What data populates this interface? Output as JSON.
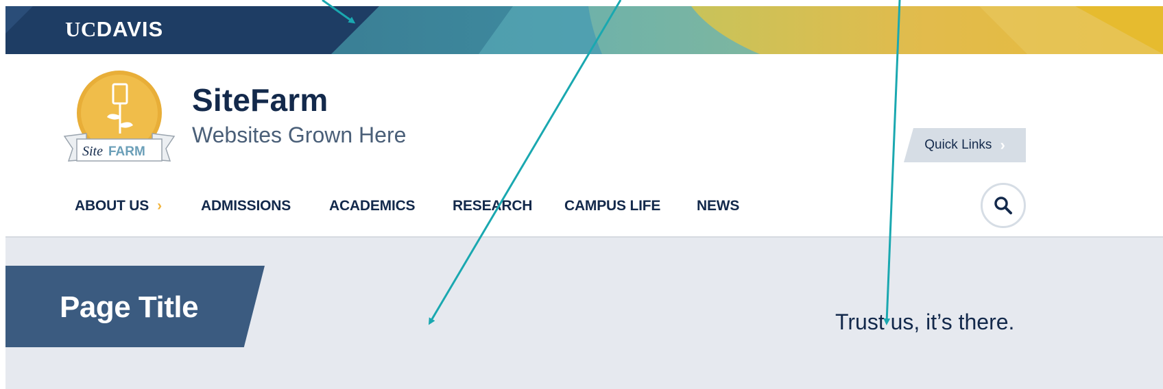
{
  "banner": {
    "brand_uc": "UC",
    "brand_davis": "DAVIS"
  },
  "branding": {
    "logo_text_site": "Site",
    "logo_text_farm": "FARM",
    "site_name": "SiteFarm",
    "slogan": "Websites Grown Here",
    "quick_links_label": "Quick Links"
  },
  "nav": {
    "items": [
      {
        "label": "ABOUT US",
        "has_arrow": true
      },
      {
        "label": "ADMISSIONS"
      },
      {
        "label": "ACADEMICS"
      },
      {
        "label": "RESEARCH"
      },
      {
        "label": "CAMPUS LIFE"
      },
      {
        "label": "NEWS"
      }
    ]
  },
  "content": {
    "page_title": "Page Title",
    "annotation": "Trust us, it’s there."
  },
  "colors": {
    "navy": "#13294b",
    "banner_blue": "#1e3d64",
    "title_box": "#3b5b80",
    "arrow_teal": "#1aa8b0",
    "gold": "#f2b43c",
    "content_bg": "#e6e9ef"
  },
  "icons": {
    "search": "search-icon",
    "chevron": "chevron-right-icon",
    "logo": "sitefarm-logo"
  }
}
